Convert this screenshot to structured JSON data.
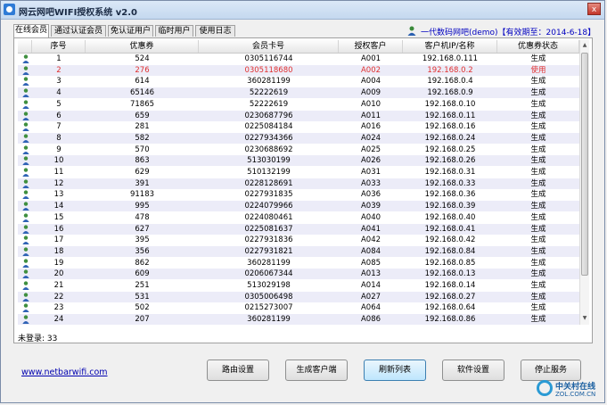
{
  "window": {
    "title": "网云网吧WIFI授权系统 v2.0",
    "close": "x"
  },
  "tabs": [
    {
      "label": "在线会员",
      "active": true
    },
    {
      "label": "通过认证会员",
      "active": false
    },
    {
      "label": "免认证用户",
      "active": false
    },
    {
      "label": "临时用户",
      "active": false
    },
    {
      "label": "使用日志",
      "active": false
    }
  ],
  "user_info": "一代数码网吧(demo)【有效期至：2014-6-18】",
  "table": {
    "columns": [
      "序号",
      "优惠券",
      "会员卡号",
      "授权客户",
      "客户机IP/名称",
      "优惠券状态"
    ],
    "rows": [
      [
        "1",
        "524",
        "0305116744",
        "A001",
        "192.168.0.111",
        "生成"
      ],
      [
        "2",
        "276",
        "0305118680",
        "A002",
        "192.168.0.2",
        "使用"
      ],
      [
        "3",
        "614",
        "360281199",
        "A004",
        "192.168.0.4",
        "生成"
      ],
      [
        "4",
        "65146",
        "52222619",
        "A009",
        "192.168.0.9",
        "生成"
      ],
      [
        "5",
        "71865",
        "52222619",
        "A010",
        "192.168.0.10",
        "生成"
      ],
      [
        "6",
        "659",
        "0230687796",
        "A011",
        "192.168.0.11",
        "生成"
      ],
      [
        "7",
        "281",
        "0225084184",
        "A016",
        "192.168.0.16",
        "生成"
      ],
      [
        "8",
        "582",
        "0227934366",
        "A024",
        "192.168.0.24",
        "生成"
      ],
      [
        "9",
        "570",
        "0230688692",
        "A025",
        "192.168.0.25",
        "生成"
      ],
      [
        "10",
        "863",
        "513030199",
        "A026",
        "192.168.0.26",
        "生成"
      ],
      [
        "11",
        "629",
        "510132199",
        "A031",
        "192.168.0.31",
        "生成"
      ],
      [
        "12",
        "391",
        "0228128691",
        "A033",
        "192.168.0.33",
        "生成"
      ],
      [
        "13",
        "91183",
        "0227931835",
        "A036",
        "192.168.0.36",
        "生成"
      ],
      [
        "14",
        "995",
        "0224079966",
        "A039",
        "192.168.0.39",
        "生成"
      ],
      [
        "15",
        "478",
        "0224080461",
        "A040",
        "192.168.0.40",
        "生成"
      ],
      [
        "16",
        "627",
        "0225081637",
        "A041",
        "192.168.0.41",
        "生成"
      ],
      [
        "17",
        "395",
        "0227931836",
        "A042",
        "192.168.0.42",
        "生成"
      ],
      [
        "18",
        "356",
        "0227931821",
        "A084",
        "192.168.0.84",
        "生成"
      ],
      [
        "19",
        "862",
        "360281199",
        "A085",
        "192.168.0.85",
        "生成"
      ],
      [
        "20",
        "609",
        "0206067344",
        "A013",
        "192.168.0.13",
        "生成"
      ],
      [
        "21",
        "251",
        "513029198",
        "A014",
        "192.168.0.14",
        "生成"
      ],
      [
        "22",
        "531",
        "0305006498",
        "A027",
        "192.168.0.27",
        "生成"
      ],
      [
        "23",
        "502",
        "0215273007",
        "A064",
        "192.168.0.64",
        "生成"
      ],
      [
        "24",
        "207",
        "360281199",
        "A086",
        "192.168.0.86",
        "生成"
      ]
    ],
    "selected_row": 1
  },
  "status": "未登录: 33",
  "site_link": "www.netbarwifi.com",
  "buttons": {
    "router": "路由设置",
    "gen_client": "生成客户端",
    "refresh": "刷新列表",
    "software": "软件设置",
    "stop": "停止服务"
  },
  "watermark": {
    "title": "中关村在线",
    "sub": "ZOL.COM.CN"
  },
  "colors": {
    "selected_text": "#e03030",
    "link": "#0000b0",
    "row_alt": "#ececf8"
  }
}
